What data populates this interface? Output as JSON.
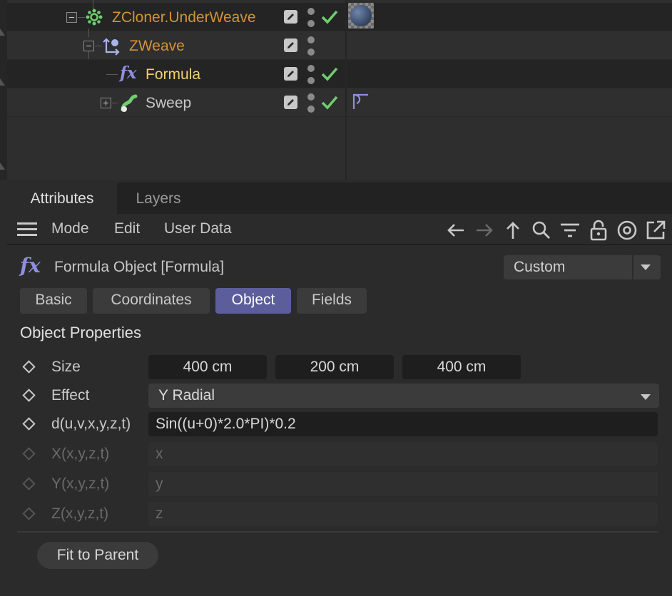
{
  "object_manager": {
    "rows": [
      {
        "name": "ZCloner.UnderWeave",
        "name_color": "#d4923a",
        "icon": "cloner-icon",
        "check": true,
        "tag": "material-tag-icon"
      },
      {
        "name": "ZWeave",
        "name_color": "#d4923a",
        "icon": "weave-icon",
        "check": false
      },
      {
        "name": "Formula",
        "name_color": "#f0d070",
        "icon": "formula-icon",
        "check": true,
        "selected": true
      },
      {
        "name": "Sweep",
        "name_color": "#c8c8c8",
        "icon": "sweep-icon",
        "check": true,
        "tag": "phong-tag-icon"
      }
    ]
  },
  "attributes": {
    "tabs": [
      {
        "label": "Attributes",
        "active": true
      },
      {
        "label": "Layers",
        "active": false
      }
    ],
    "menu": {
      "mode": "Mode",
      "edit": "Edit",
      "user_data": "User Data"
    },
    "toolbar_icons": [
      "back-arrow-icon",
      "forward-arrow-icon",
      "up-arrow-icon",
      "search-icon",
      "filter-icon",
      "lock-icon",
      "target-icon",
      "new-window-icon"
    ],
    "title": "Formula Object [Formula]",
    "preset_dropdown": "Custom",
    "page_tabs": [
      {
        "label": "Basic",
        "active": false
      },
      {
        "label": "Coordinates",
        "active": false
      },
      {
        "label": "Object",
        "active": true
      },
      {
        "label": "Fields",
        "active": false
      }
    ],
    "section_title": "Object Properties",
    "size": {
      "label": "Size",
      "x": "400 cm",
      "y": "200 cm",
      "z": "400 cm"
    },
    "effect": {
      "label": "Effect",
      "value": "Y Radial"
    },
    "d_func": {
      "label": "d(u,v,x,y,z,t)",
      "value": "Sin((u+0)*2.0*PI)*0.2"
    },
    "x_func": {
      "label": "X(x,y,z,t)",
      "value": "x"
    },
    "y_func": {
      "label": "Y(x,y,z,t)",
      "value": "y"
    },
    "z_func": {
      "label": "Z(x,y,z,t)",
      "value": "z"
    },
    "fit_button": "Fit to Parent"
  },
  "colors": {
    "accent_tab": "#5c5e9c",
    "check": "#6fce6f",
    "fx": "#8f8fe0"
  }
}
